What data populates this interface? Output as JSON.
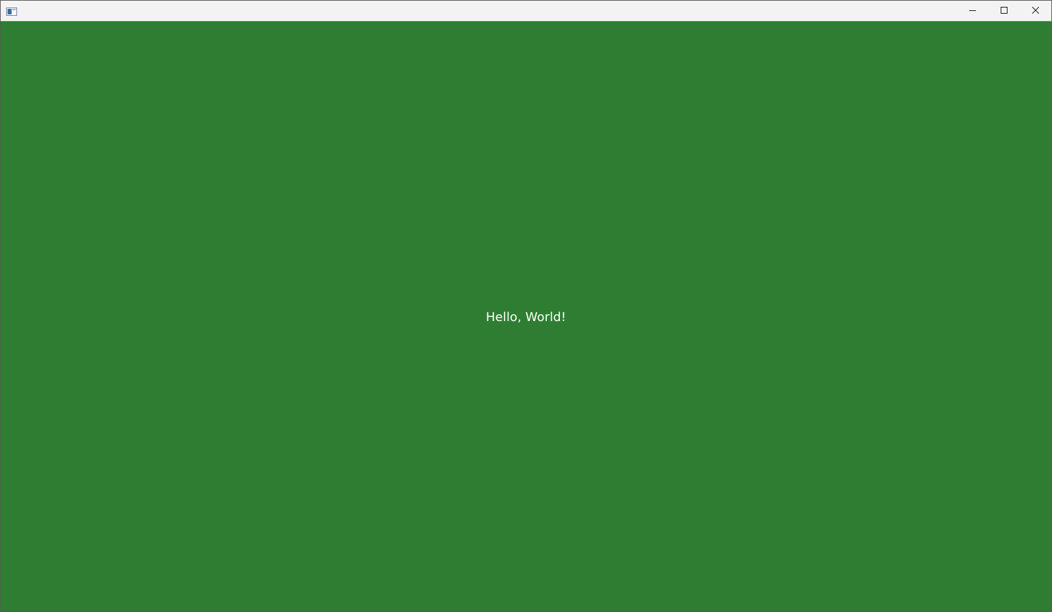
{
  "window": {
    "title": "",
    "app_icon": "app-window-icon",
    "caption_buttons": {
      "minimize": "minimize-icon",
      "maximize": "maximize-icon",
      "close": "close-icon"
    }
  },
  "content": {
    "greeting": "Hello, World!",
    "background_color": "#2f7d33",
    "text_color": "#ffffff"
  }
}
